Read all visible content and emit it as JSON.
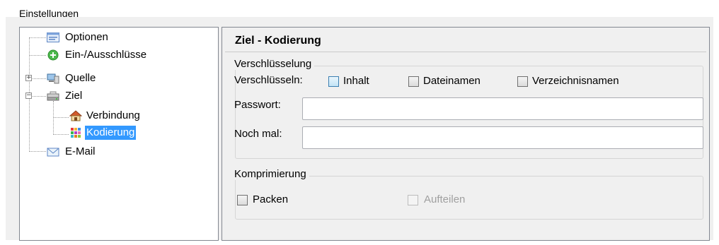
{
  "group": {
    "mnemonic": "E",
    "rest": "instellungen"
  },
  "tree": {
    "items": [
      {
        "label": "Optionen",
        "icon": "options-icon"
      },
      {
        "label": "Ein-/Ausschlüsse",
        "icon": "green-plus-icon"
      },
      {
        "label": "Quelle",
        "icon": "computer-icon",
        "expander": "+"
      },
      {
        "label": "Ziel",
        "icon": "server-icon",
        "expander": "−"
      },
      {
        "label": "Verbindung",
        "icon": "house-icon"
      },
      {
        "label": "Kodierung",
        "icon": "colored-grid-icon",
        "selected": true
      },
      {
        "label": "E-Mail",
        "icon": "envelope-icon"
      }
    ]
  },
  "panel": {
    "title": "Ziel - Kodierung",
    "encryption": {
      "legend": "Verschlüsselung",
      "encrypt_label": "Verschlüsseln:",
      "options": [
        {
          "label": "Inhalt",
          "checked": false
        },
        {
          "label": "Dateinamen",
          "checked": false
        },
        {
          "label": "Verzeichnisnamen",
          "checked": false
        }
      ],
      "password_label": "Passwort:",
      "password_value": "",
      "repeat_label": "Noch mal:",
      "repeat_value": ""
    },
    "compression": {
      "legend": "Komprimierung",
      "pack_label": "Packen",
      "split_label": "Aufteilen",
      "split_disabled": true
    }
  },
  "colors": {
    "selection": "#3399ff",
    "panel_bg": "#f0f0f0",
    "border": "#828790"
  }
}
